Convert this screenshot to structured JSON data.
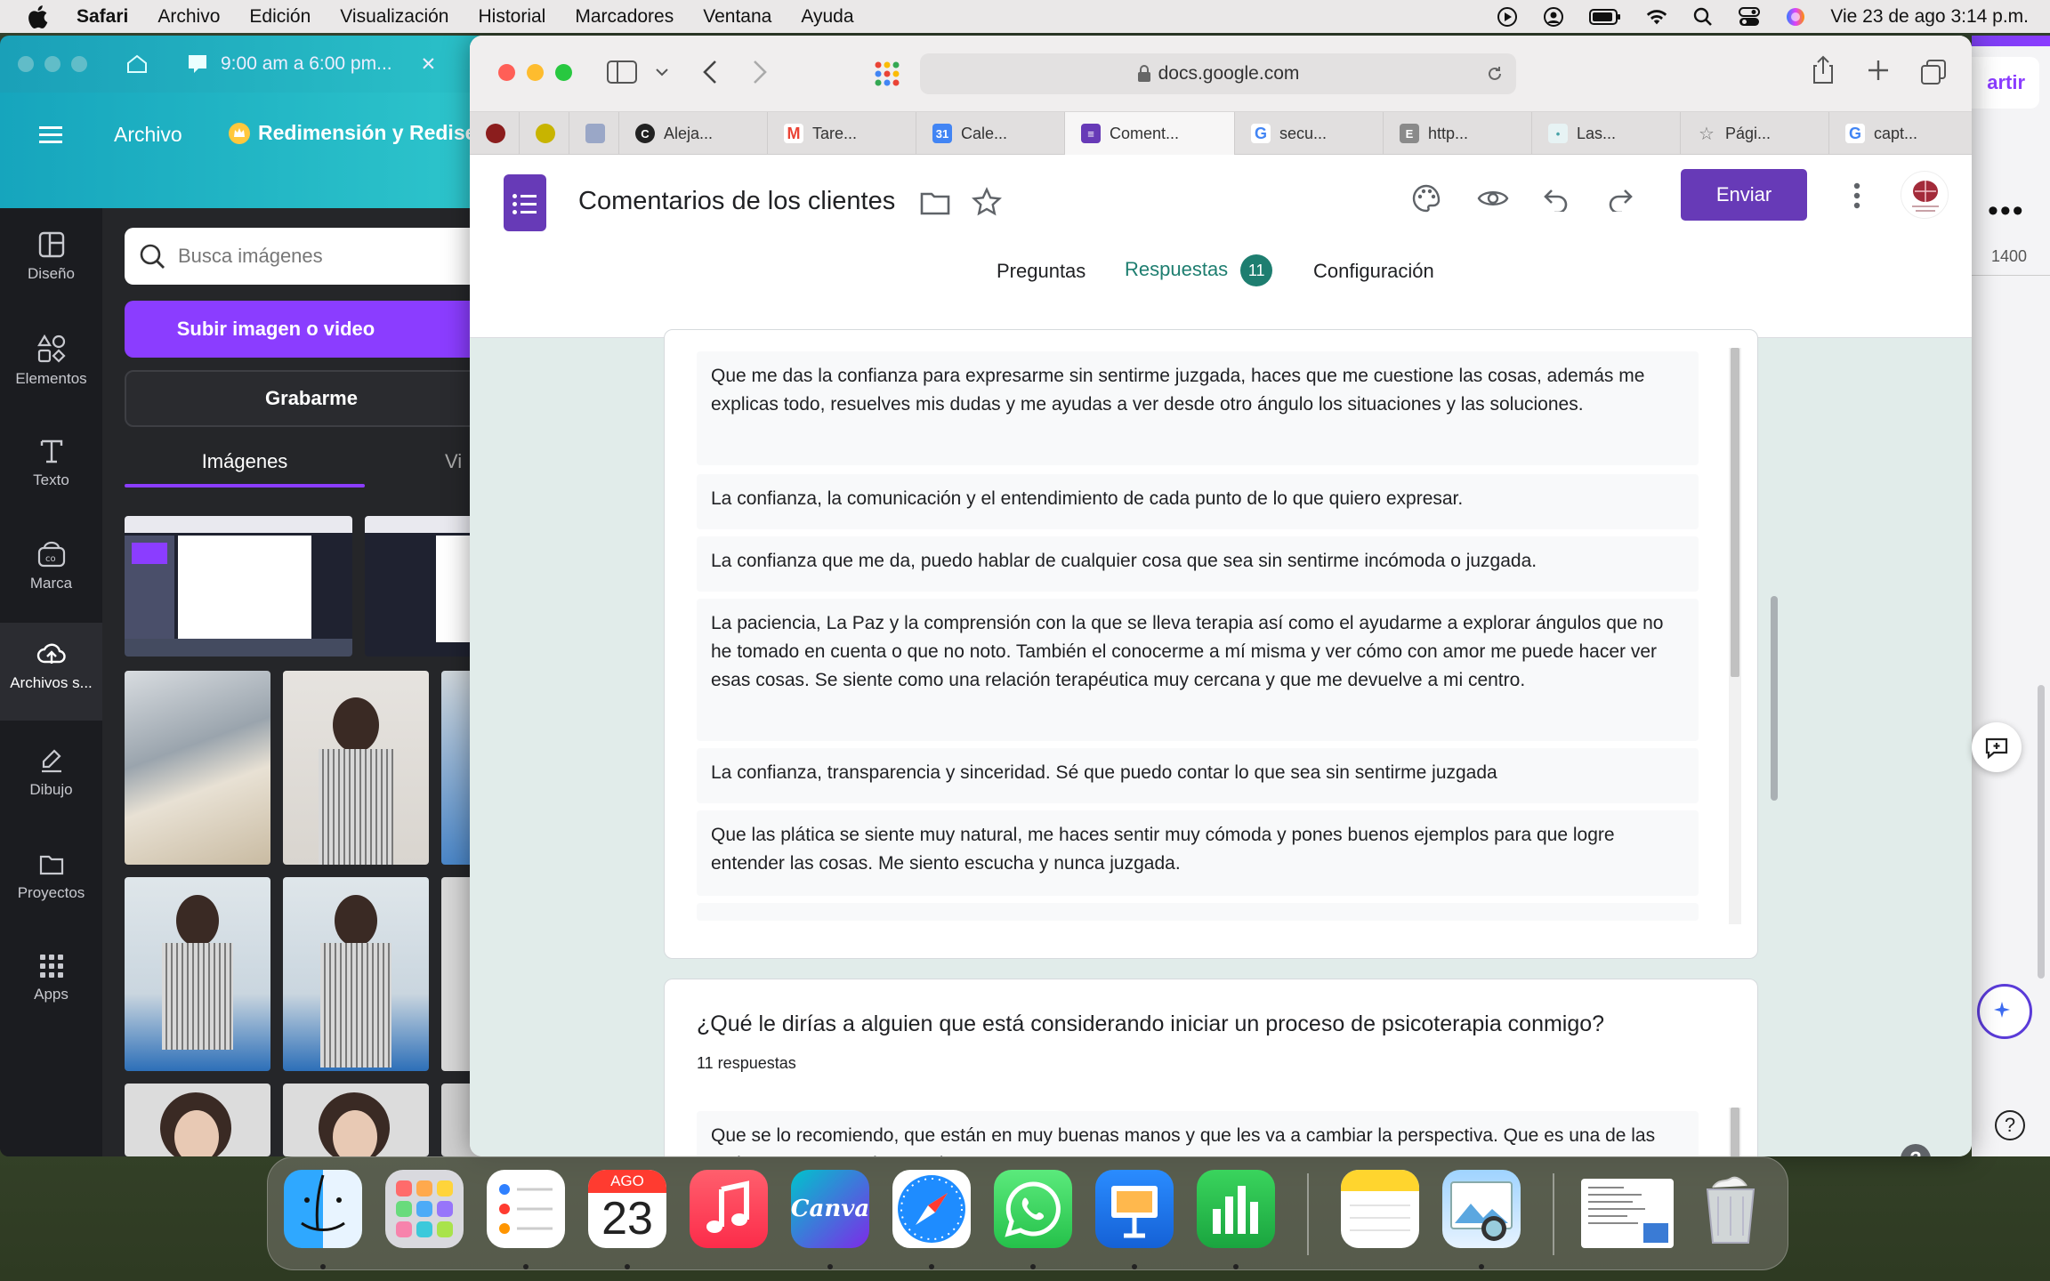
{
  "menubar": {
    "app": "Safari",
    "items": [
      "Archivo",
      "Edición",
      "Visualización",
      "Historial",
      "Marcadores",
      "Ventana",
      "Ayuda"
    ],
    "clock": "Vie 23 de ago  3:14 p.m."
  },
  "canva": {
    "tab_title": "9:00 am a 6:00 pm...",
    "menu_file": "Archivo",
    "project_name": "Redimensión y Redise",
    "share_partial": "artir",
    "ruler_mark": "1400",
    "rail": [
      {
        "label": "Diseño",
        "icon": "layout-icon"
      },
      {
        "label": "Elementos",
        "icon": "shapes-icon"
      },
      {
        "label": "Texto",
        "icon": "text-icon"
      },
      {
        "label": "Marca",
        "icon": "brand-icon"
      },
      {
        "label": "Archivos s...",
        "icon": "cloud-upload-icon"
      },
      {
        "label": "Dibujo",
        "icon": "draw-icon"
      },
      {
        "label": "Proyectos",
        "icon": "folder-icon"
      },
      {
        "label": "Apps",
        "icon": "apps-grid-icon"
      }
    ],
    "search_placeholder": "Busca imágenes",
    "upload_button": "Subir imagen o video",
    "record_button": "Grabarme",
    "tab_images": "Imágenes",
    "tab_videos": "Vi"
  },
  "safari": {
    "address": "docs.google.com",
    "tabs": [
      {
        "label": "",
        "color": "#8b1d1d"
      },
      {
        "label": "",
        "color": "#c8b400"
      },
      {
        "label": "",
        "color": "#9aa7c7"
      },
      {
        "label": "Aleja...",
        "color": "#222222"
      },
      {
        "label": "Tare...",
        "color": "#ea4335"
      },
      {
        "label": "Cale...",
        "color": "#4285f4"
      },
      {
        "label": "Coment...",
        "color": "#673ab7",
        "active": true
      },
      {
        "label": "secu...",
        "color": "#4285f4"
      },
      {
        "label": "http...",
        "color": "#8a8a8a"
      },
      {
        "label": "Las...",
        "color": "#4aa3a8"
      },
      {
        "label": "Pági...",
        "color": "#777777"
      },
      {
        "label": "capt...",
        "color": "#4285f4"
      }
    ]
  },
  "forms": {
    "title": "Comentarios de los clientes",
    "send_button": "Enviar",
    "tabs": {
      "questions": "Preguntas",
      "responses": "Respuestas",
      "settings": "Configuración"
    },
    "response_count_badge": "11",
    "responses": [
      "Que me das la confianza para expresarme sin sentirme juzgada, haces que me cuestione las cosas, además me explicas todo, resuelves mis dudas y me ayudas a ver desde otro ángulo los situaciones y las soluciones.",
      "La confianza, la comunicación y el entendimiento de cada punto de lo que quiero expresar.",
      "La confianza que me da, puedo hablar de cualquier cosa que sea sin sentirme incómoda o juzgada.",
      "La paciencia, La Paz y la comprensión con la que se lleva terapia así como el ayudarme a explorar ángulos que no he tomado en cuenta o que no noto. También el conocerme a mí misma y ver cómo con amor me puede hacer ver esas cosas. Se siente como una relación terapéutica muy cercana y que me devuelve a mi centro.",
      "La confianza, transparencia y sinceridad. Sé que puedo contar lo que sea sin sentirme juzgada",
      "Que las plática se siente muy natural, me haces sentir muy cómoda y pones buenos ejemplos para que logre entender las cosas. Me siento escucha y nunca juzgada."
    ],
    "question2": {
      "title": "¿Qué le dirías a alguien que está considerando iniciar un proceso de psicoterapia conmigo?",
      "count": "11 respuestas",
      "first_response": "Que se lo recomiendo, que están en muy buenas manos y que les va a cambiar la perspectiva. Que es una de las mejores cosas que les puede pasar."
    }
  },
  "dock": {
    "calendar_month": "AGO",
    "calendar_day": "23",
    "canva_label": "Canva",
    "apps": [
      "finder-icon",
      "launchpad-icon",
      "reminders-icon",
      "calendar-icon",
      "music-icon",
      "canva-icon",
      "safari-icon",
      "whatsapp-icon",
      "keynote-icon",
      "numbers-icon",
      "notes-icon",
      "preview-icon",
      "document-thumbnail-icon",
      "trash-icon"
    ]
  }
}
